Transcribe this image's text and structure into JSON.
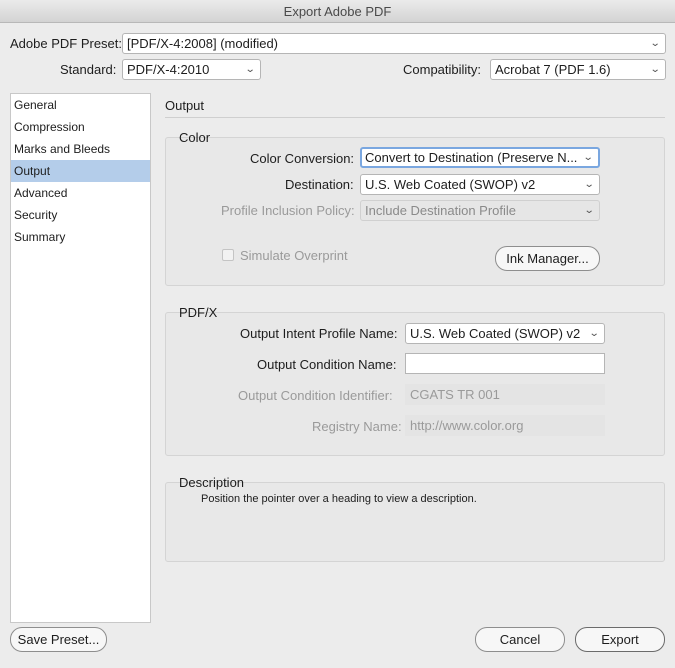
{
  "window": {
    "title": "Export Adobe PDF"
  },
  "preset": {
    "label": "Adobe PDF Preset:",
    "value": "[PDF/X-4:2008] (modified)"
  },
  "standard": {
    "label": "Standard:",
    "value": "PDF/X-4:2010"
  },
  "compatibility": {
    "label": "Compatibility:",
    "value": "Acrobat 7 (PDF 1.6)"
  },
  "sidebar": {
    "items": [
      {
        "label": "General"
      },
      {
        "label": "Compression"
      },
      {
        "label": "Marks and Bleeds"
      },
      {
        "label": "Output"
      },
      {
        "label": "Advanced"
      },
      {
        "label": "Security"
      },
      {
        "label": "Summary"
      }
    ],
    "selected": "Output"
  },
  "panel": {
    "title": "Output"
  },
  "color": {
    "group_title": "Color",
    "conversion_label": "Color Conversion:",
    "conversion_value": "Convert to Destination (Preserve N...",
    "destination_label": "Destination:",
    "destination_value": "U.S. Web Coated (SWOP) v2",
    "policy_label": "Profile Inclusion Policy:",
    "policy_value": "Include Destination Profile",
    "simulate_label": "Simulate Overprint",
    "ink_button": "Ink Manager..."
  },
  "pdfx": {
    "group_title": "PDF/X",
    "intent_label": "Output Intent Profile Name:",
    "intent_value": "U.S. Web Coated (SWOP) v2",
    "condition_name_label": "Output Condition Name:",
    "condition_name_value": "",
    "condition_id_label": "Output Condition Identifier:",
    "condition_id_value": "CGATS TR 001",
    "registry_label": "Registry Name:",
    "registry_value": "http://www.color.org"
  },
  "description": {
    "group_title": "Description",
    "text": "Position the pointer over a heading to view a description."
  },
  "footer": {
    "save_preset": "Save Preset...",
    "cancel": "Cancel",
    "export": "Export"
  },
  "icons": {
    "dropdown": "chevron-down-icon"
  }
}
